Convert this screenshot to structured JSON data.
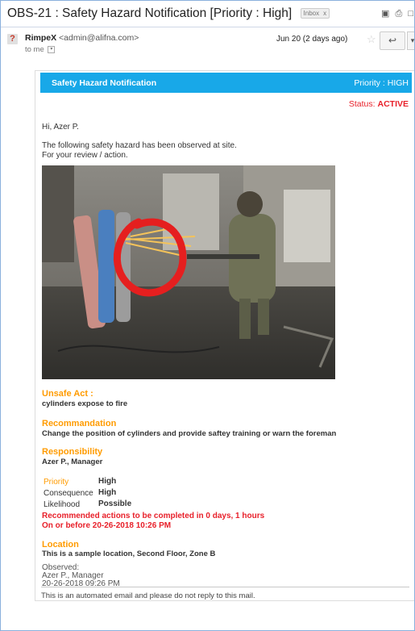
{
  "subject": "OBS-21 : Safety Hazard Notification [Priority : High]",
  "inbox_badge": "Inbox",
  "inbox_badge_close": "x",
  "sender": {
    "avatar_char": "?",
    "name": "RimpeX",
    "address": "<admin@alifna.com>",
    "to_me": "to me",
    "date": "Jun 20 (2 days ago)"
  },
  "card": {
    "header_title": "Safety Hazard Notification",
    "header_priority": "Priority : HIGH",
    "status_label": "Status: ",
    "status_value": "ACTIVE",
    "greeting": "Hi, Azer P.",
    "intro_line1": "The following safety hazard has been observed at site.",
    "intro_line2": "For your review / action.",
    "unsafe_act_label": "Unsafe Act :",
    "unsafe_act_value": "cylinders expose to fire",
    "recommendation_label": "Recommandation",
    "recommendation_value": "Change the position of cylinders and provide saftey training or warn the foreman",
    "responsibility_label": "Responsibility",
    "responsibility_value": "Azer P., Manager",
    "ratings": [
      {
        "label": "Priority",
        "value": "High"
      },
      {
        "label": "Consequence",
        "value": "High"
      },
      {
        "label": "Likelihood",
        "value": "Possible"
      }
    ],
    "recommended_line1": "Recommended actions to be completed in 0 days, 1 hours",
    "recommended_line2": "On or before 20-26-2018 10:26 PM",
    "location_label": "Location",
    "location_value": "This is a sample location, Second Floor, Zone B",
    "observed_label": "Observed:",
    "observed_by": "Azer P., Manager",
    "observed_time": "20-26-2018 09:26 PM",
    "footer": "This is an automated email and please do not reply to this mail."
  },
  "colors": {
    "header_blue": "#18a8e8",
    "accent_orange": "#ff9b00",
    "alert_red": "#e8202a"
  }
}
